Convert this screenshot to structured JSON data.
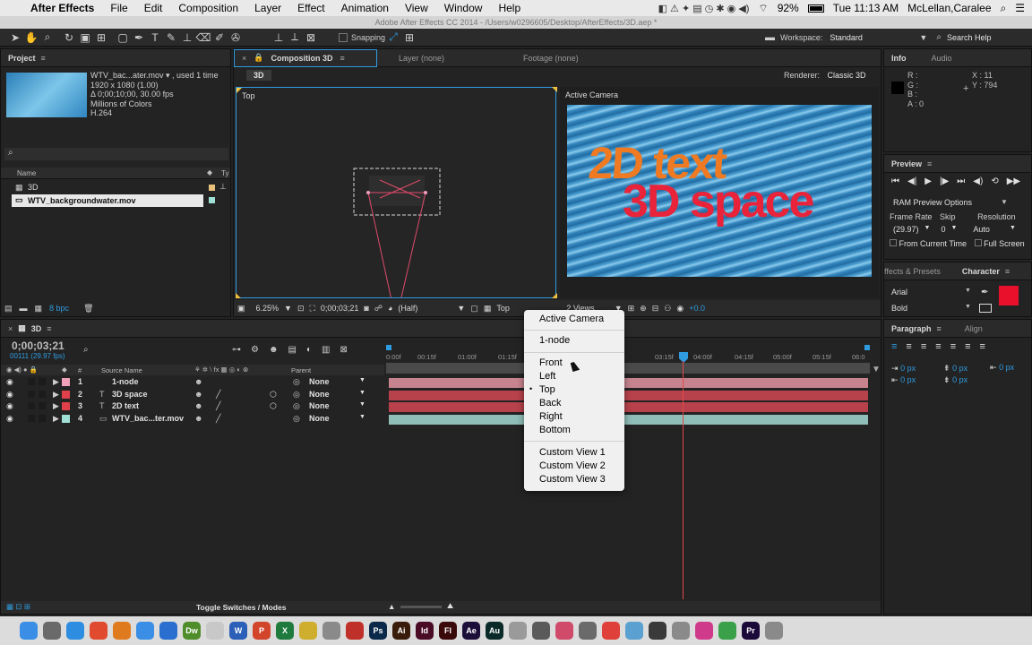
{
  "menubar": {
    "app": "After Effects",
    "items": [
      "File",
      "Edit",
      "Composition",
      "Layer",
      "Effect",
      "Animation",
      "View",
      "Window",
      "Help"
    ],
    "battery": "92%",
    "clock": "Tue 11:13 AM",
    "user": "McLellan,Caralee"
  },
  "window_title": "Adobe After Effects CC 2014 - /Users/w0296605/Desktop/AfterEffects/3D.aep *",
  "toolbar": {
    "snapping_label": "Snapping",
    "workspace_label": "Workspace:",
    "workspace_value": "Standard",
    "search_help": "Search Help"
  },
  "project": {
    "title": "Project",
    "file_name": "WTV_bac...ater.mov ▾ , used 1 time",
    "dims": "1920 x 1080 (1.00)",
    "duration": "Δ 0;00;10;00, 30.00 fps",
    "colors": "Millions of Colors",
    "codec": "H.264",
    "search_icon": "search-icon",
    "col_name": "Name",
    "col_type": "Ty",
    "items": [
      {
        "name": "3D",
        "color": "#e8c07a"
      },
      {
        "name": "WTV_backgroundwater.mov",
        "color": "#9fe0d6"
      }
    ],
    "bpc": "8 bpc"
  },
  "comp": {
    "tab_label": "Composition 3D",
    "layer_tab": "Layer (none)",
    "footage_tab": "Footage (none)",
    "crumb": "3D",
    "renderer_label": "Renderer:",
    "renderer_value": "Classic 3D",
    "left_view_label": "Top",
    "right_view_label": "Active Camera",
    "text_line1": "2D text",
    "text_line2": "3D space",
    "zoom": "6.25%",
    "timecode": "0;00;03;21",
    "resolution": "(Half)",
    "view_select": "Top",
    "views": "2 Views",
    "exposure": "+0.0",
    "colors": {
      "text1": "#f07a22",
      "text2": "#e8233a",
      "water": "#3d8fc4"
    }
  },
  "view_menu": {
    "items": [
      {
        "label": "Active Camera",
        "checked": false
      },
      {
        "label": "1-node",
        "checked": false
      },
      {
        "label": "Front",
        "checked": false
      },
      {
        "label": "Left",
        "checked": false
      },
      {
        "label": "Top",
        "checked": true
      },
      {
        "label": "Back",
        "checked": false
      },
      {
        "label": "Right",
        "checked": false
      },
      {
        "label": "Bottom",
        "checked": false
      },
      {
        "label": "Custom View 1",
        "checked": false
      },
      {
        "label": "Custom View 2",
        "checked": false
      },
      {
        "label": "Custom View 3",
        "checked": false
      }
    ]
  },
  "info": {
    "title": "Info",
    "audio_tab": "Audio",
    "r": "R :",
    "g": "G :",
    "b": "B :",
    "a": "A : 0",
    "x": "X : 11",
    "y": "Y : 794"
  },
  "preview": {
    "title": "Preview",
    "ram_options": "RAM Preview Options",
    "frame_rate_label": "Frame Rate",
    "skip_label": "Skip",
    "resolution_label": "Resolution",
    "frame_rate_value": "(29.97)",
    "skip_value": "0",
    "resolution_value": "Auto",
    "from_current": "From Current Time",
    "full_screen": "Full Screen"
  },
  "character": {
    "effects_tab": "ffects & Presets",
    "title": "Character",
    "font": "Arial",
    "style": "Bold",
    "fill_color": "#e8102a"
  },
  "paragraph": {
    "title": "Paragraph",
    "align_tab": "Align",
    "px_values": [
      "0 px",
      "0 px",
      "0 px",
      "0 px",
      "0 px"
    ]
  },
  "timeline": {
    "tab": "3D",
    "timecode": "0;00;03;21",
    "frames": "00111 (29.97 fps)",
    "col_num": "#",
    "col_source": "Source Name",
    "col_parent": "Parent",
    "ruler": [
      "0:00f",
      "00:15f",
      "01:00f",
      "01:15f",
      "03:15f",
      "04:00f",
      "04:15f",
      "05:00f",
      "05:15f",
      "06:0"
    ],
    "layers": [
      {
        "num": "1",
        "name": "1-node",
        "color": "#f0a0b8",
        "parent": "None"
      },
      {
        "num": "2",
        "name": "3D space",
        "color": "#e0404a",
        "parent": "None"
      },
      {
        "num": "3",
        "name": "2D text",
        "color": "#e0404a",
        "parent": "None"
      },
      {
        "num": "4",
        "name": "WTV_bac...ter.mov",
        "color": "#9fe0d6",
        "parent": "None"
      }
    ],
    "toggle": "Toggle Switches / Modes"
  },
  "dock": {
    "apps": [
      {
        "label": "",
        "color": "#3a8ee6"
      },
      {
        "label": "",
        "color": "#6a6a6a"
      },
      {
        "label": "",
        "color": "#2d8de0"
      },
      {
        "label": "",
        "color": "#e04a2e"
      },
      {
        "label": "",
        "color": "#e07a1e"
      },
      {
        "label": "",
        "color": "#3a8ee6"
      },
      {
        "label": "",
        "color": "#2a6fd0"
      },
      {
        "label": "Dw",
        "color": "#4e8d2a"
      },
      {
        "label": "",
        "color": "#c8c8c8"
      },
      {
        "label": "W",
        "color": "#2b5fb8"
      },
      {
        "label": "P",
        "color": "#d2452b"
      },
      {
        "label": "X",
        "color": "#1f7a3e"
      },
      {
        "label": "",
        "color": "#cfae2e"
      },
      {
        "label": "",
        "color": "#8a8a8a"
      },
      {
        "label": "",
        "color": "#c0302a"
      },
      {
        "label": "Ps",
        "color": "#0b2a4a"
      },
      {
        "label": "Ai",
        "color": "#3a1c0a"
      },
      {
        "label": "Id",
        "color": "#4a0b24"
      },
      {
        "label": "Fl",
        "color": "#3a0a0a"
      },
      {
        "label": "Ae",
        "color": "#1b0f3a"
      },
      {
        "label": "Au",
        "color": "#0a2a2a"
      },
      {
        "label": "",
        "color": "#9a9a9a"
      },
      {
        "label": "",
        "color": "#5a5a5a"
      },
      {
        "label": "",
        "color": "#d04a6a"
      },
      {
        "label": "",
        "color": "#6a6a6a"
      },
      {
        "label": "",
        "color": "#e0403a"
      },
      {
        "label": "",
        "color": "#5aa0d0"
      },
      {
        "label": "",
        "color": "#3a3a3a"
      },
      {
        "label": "",
        "color": "#8a8a8a"
      },
      {
        "label": "",
        "color": "#d03a8a"
      },
      {
        "label": "",
        "color": "#3aa04a"
      },
      {
        "label": "Pr",
        "color": "#1a0a3a"
      },
      {
        "label": "",
        "color": "#8a8a8a"
      }
    ]
  }
}
